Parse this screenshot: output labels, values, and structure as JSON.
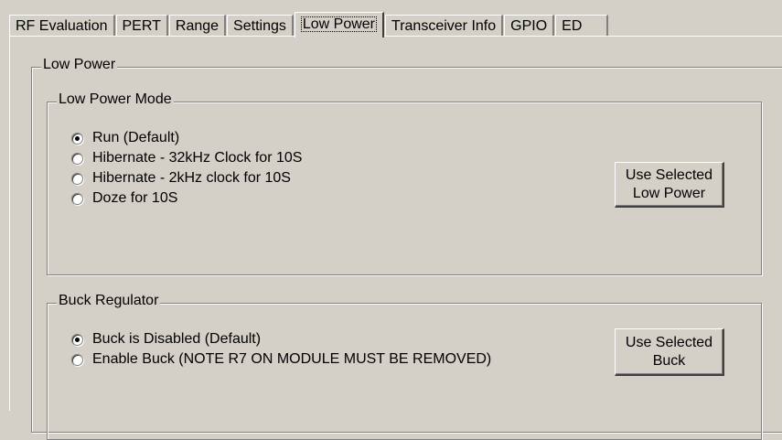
{
  "tabs": [
    {
      "label": "RF Evaluation"
    },
    {
      "label": "PERT"
    },
    {
      "label": "Range"
    },
    {
      "label": "Settings"
    },
    {
      "label": "Low Power",
      "active": true
    },
    {
      "label": "Transceiver Info"
    },
    {
      "label": "GPIO"
    },
    {
      "label": "ED"
    }
  ],
  "panel": {
    "title": "Low Power",
    "mode_group": {
      "title": "Low Power Mode",
      "options": [
        {
          "label": "Run (Default)",
          "checked": true
        },
        {
          "label": "Hibernate - 32kHz Clock for 10S",
          "checked": false
        },
        {
          "label": "Hibernate - 2kHz clock for 10S",
          "checked": false
        },
        {
          "label": "Doze for 10S",
          "checked": false
        }
      ],
      "button": {
        "line1": "Use Selected",
        "line2": "Low Power"
      }
    },
    "buck_group": {
      "title": "Buck Regulator",
      "options": [
        {
          "label": "Buck is Disabled (Default)",
          "checked": true
        },
        {
          "label": "Enable Buck (NOTE R7 ON MODULE MUST BE REMOVED)",
          "checked": false
        }
      ],
      "button": {
        "line1": "Use Selected",
        "line2": "Buck"
      }
    }
  }
}
